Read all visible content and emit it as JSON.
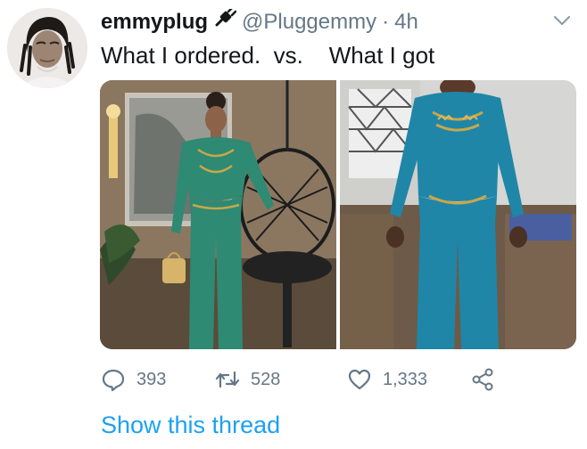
{
  "tweet": {
    "display_name": "emmyplug",
    "handle": "@Pluggemmy",
    "separator": "·",
    "time": "4h",
    "text": "What I ordered.  vs.    What I got"
  },
  "actions": {
    "reply_count": "393",
    "retweet_count": "528",
    "like_count": "1,333"
  },
  "footer": {
    "show_thread": "Show this thread"
  },
  "icons": {
    "name_badge": "plug-icon",
    "menu": "chevron-down-icon",
    "reply": "reply-icon",
    "retweet": "retweet-icon",
    "like": "heart-icon",
    "share": "share-icon"
  },
  "colors": {
    "accent": "#1da1f2",
    "muted": "#657786",
    "text": "#14171a",
    "jumpsuit_green": "#2e8a72",
    "jumpsuit_teal": "#1f86a8",
    "embroidery_gold": "#c9a64a"
  }
}
